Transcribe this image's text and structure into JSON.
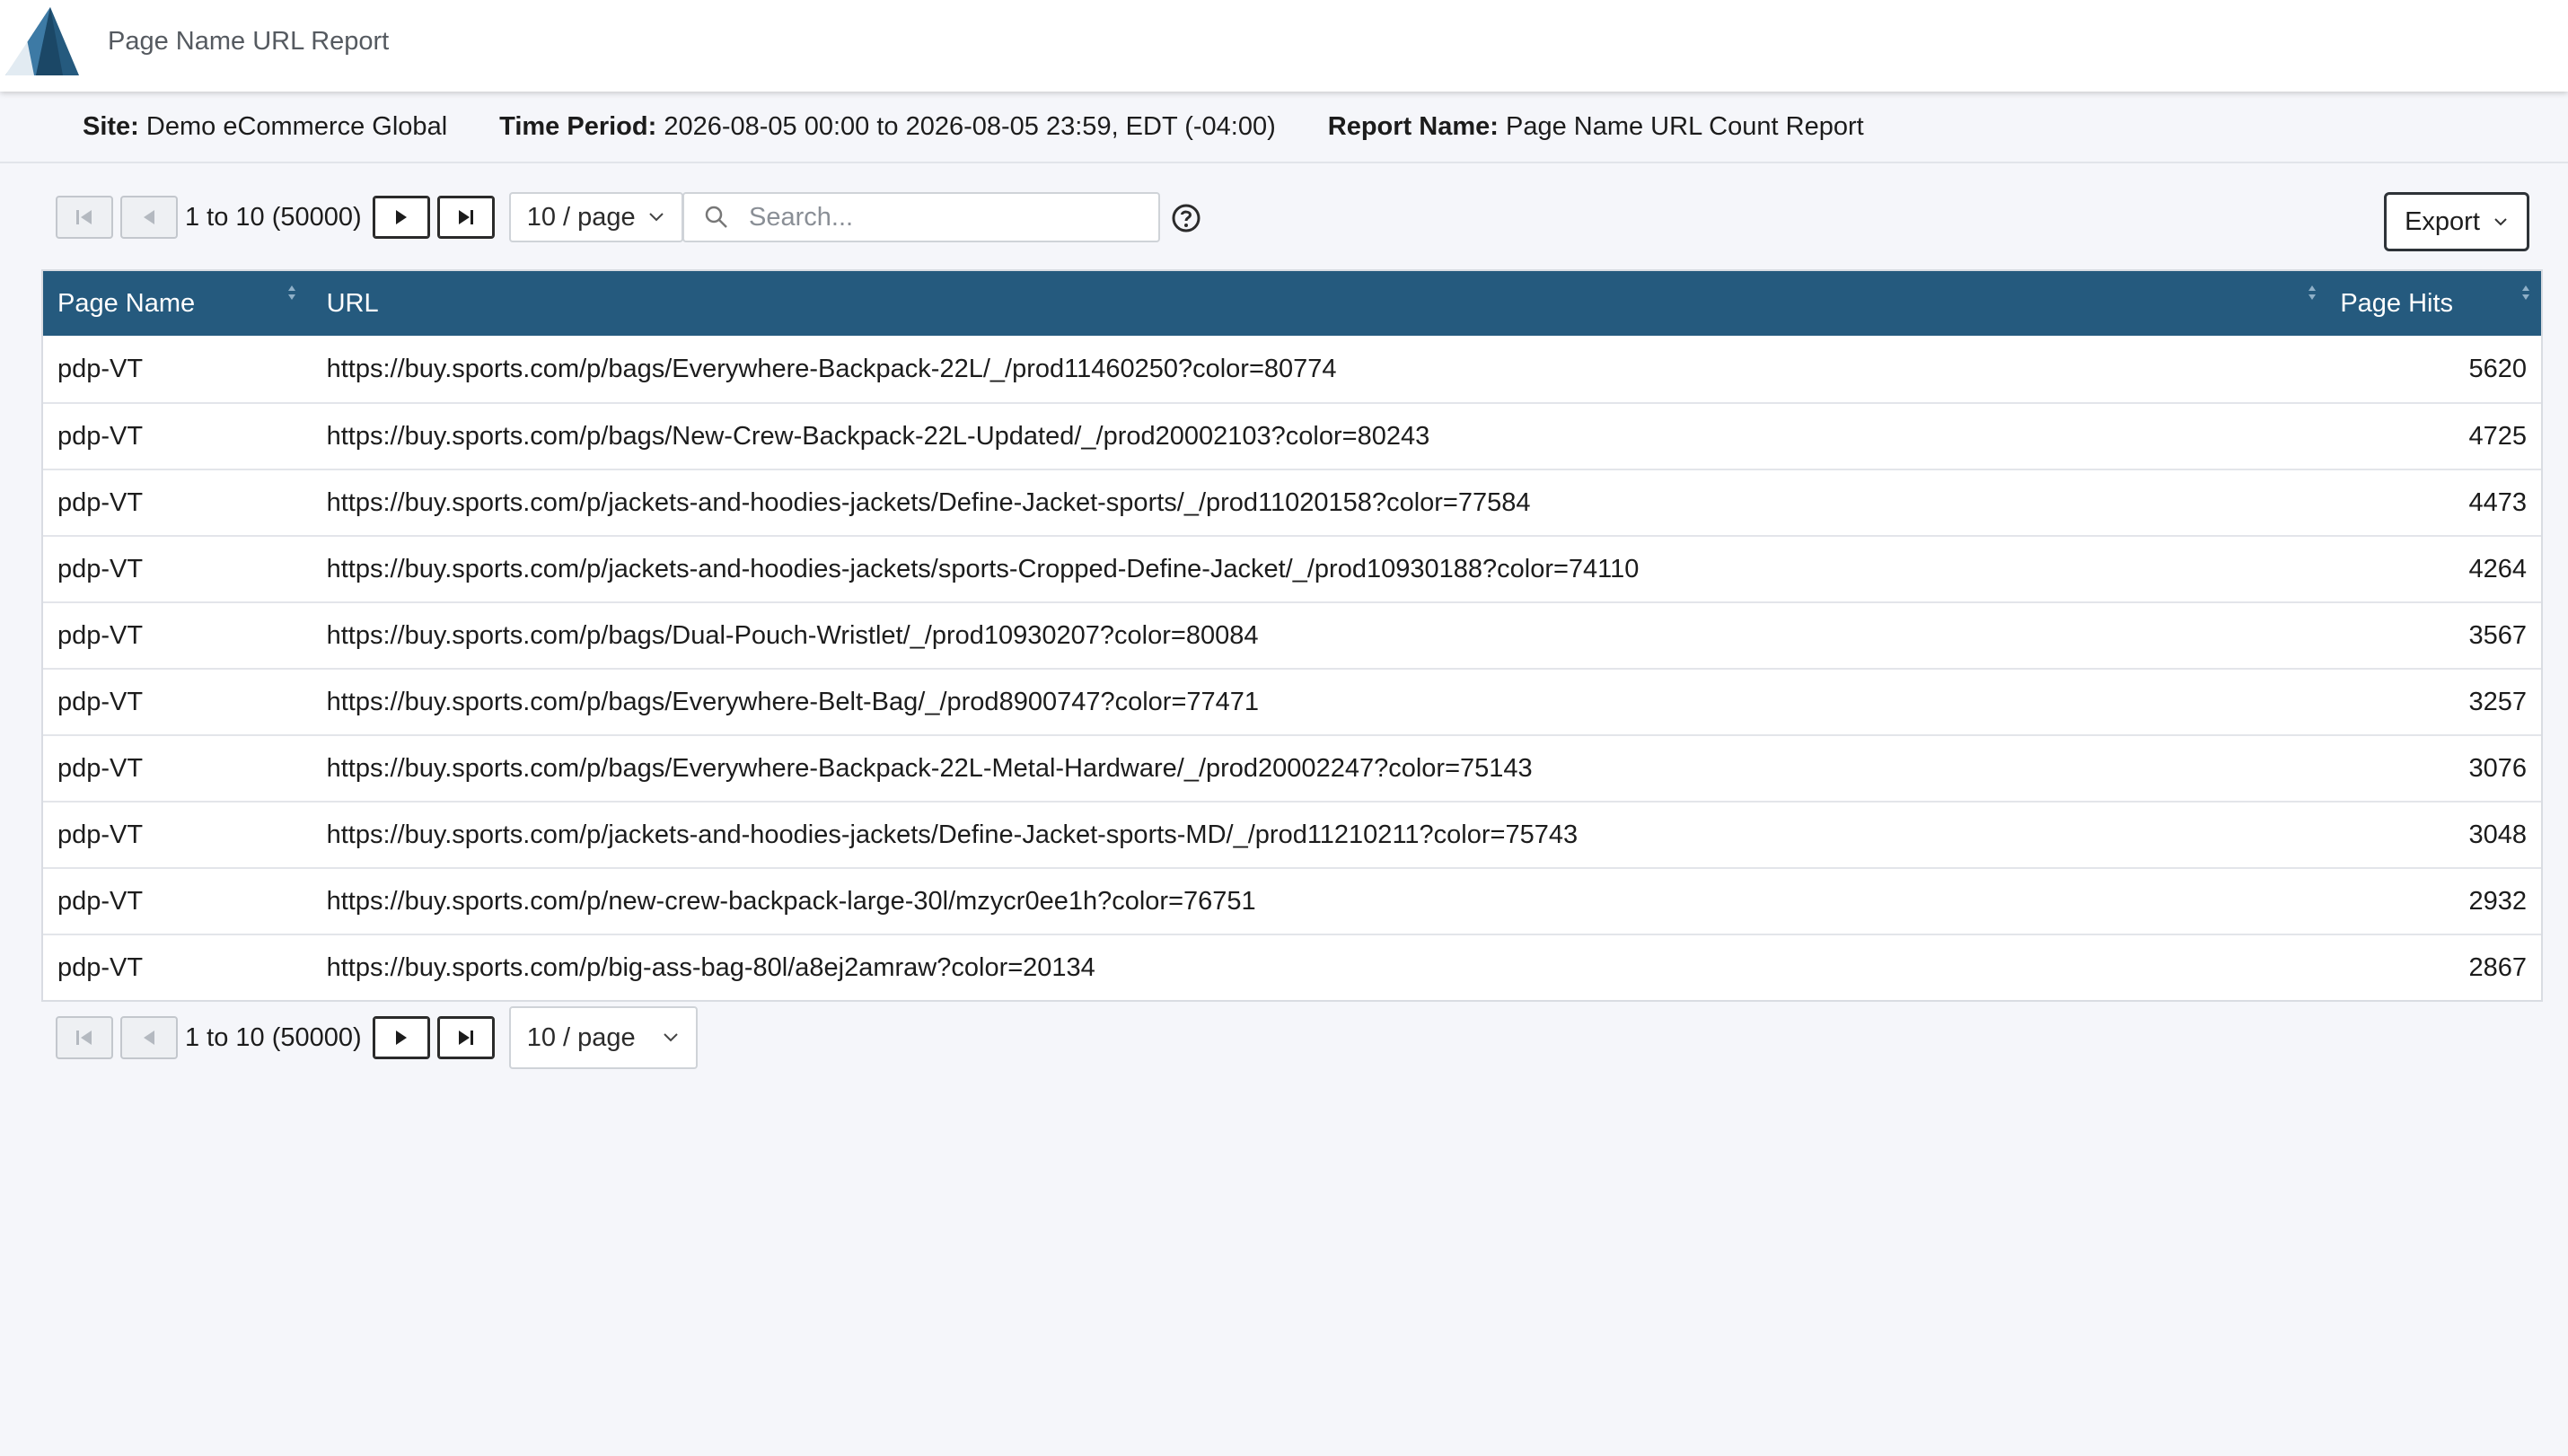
{
  "header": {
    "title": "Page Name URL Report",
    "logo_icon": "triangle-logo-icon",
    "brand_color": "#255a7e"
  },
  "info": {
    "site_label": "Site:",
    "site_value": "Demo eCommerce Global",
    "period_label": "Time Period:",
    "period_value": "2026-08-05 00:00 to 2026-08-05 23:59, EDT (-04:00)",
    "report_label": "Report Name:",
    "report_value": "Page Name URL Count Report"
  },
  "pager_top": {
    "range": "1 to 10 (50000)",
    "page_size": "10 / page"
  },
  "pager_bottom": {
    "range": "1 to 10 (50000)",
    "page_size": "10 / page"
  },
  "search": {
    "placeholder": "Search..."
  },
  "export": {
    "label": "Export"
  },
  "table": {
    "columns": [
      "Page Name",
      "URL",
      "Page Hits"
    ],
    "header_color": "#255a7e",
    "rows": [
      {
        "page_name": "pdp-VT",
        "url": "https://buy.sports.com/p/bags/Everywhere-Backpack-22L/_/prod11460250?color=80774",
        "hits": "5620"
      },
      {
        "page_name": "pdp-VT",
        "url": "https://buy.sports.com/p/bags/New-Crew-Backpack-22L-Updated/_/prod20002103?color=80243",
        "hits": "4725"
      },
      {
        "page_name": "pdp-VT",
        "url": "https://buy.sports.com/p/jackets-and-hoodies-jackets/Define-Jacket-sports/_/prod11020158?color=77584",
        "hits": "4473"
      },
      {
        "page_name": "pdp-VT",
        "url": "https://buy.sports.com/p/jackets-and-hoodies-jackets/sports-Cropped-Define-Jacket/_/prod10930188?color=74110",
        "hits": "4264"
      },
      {
        "page_name": "pdp-VT",
        "url": "https://buy.sports.com/p/bags/Dual-Pouch-Wristlet/_/prod10930207?color=80084",
        "hits": "3567"
      },
      {
        "page_name": "pdp-VT",
        "url": "https://buy.sports.com/p/bags/Everywhere-Belt-Bag/_/prod8900747?color=77471",
        "hits": "3257"
      },
      {
        "page_name": "pdp-VT",
        "url": "https://buy.sports.com/p/bags/Everywhere-Backpack-22L-Metal-Hardware/_/prod20002247?color=75143",
        "hits": "3076"
      },
      {
        "page_name": "pdp-VT",
        "url": "https://buy.sports.com/p/jackets-and-hoodies-jackets/Define-Jacket-sports-MD/_/prod11210211?color=75743",
        "hits": "3048"
      },
      {
        "page_name": "pdp-VT",
        "url": "https://buy.sports.com/p/new-crew-backpack-large-30l/mzycr0ee1h?color=76751",
        "hits": "2932"
      },
      {
        "page_name": "pdp-VT",
        "url": "https://buy.sports.com/p/big-ass-bag-80l/a8ej2amraw?color=20134",
        "hits": "2867"
      }
    ]
  }
}
